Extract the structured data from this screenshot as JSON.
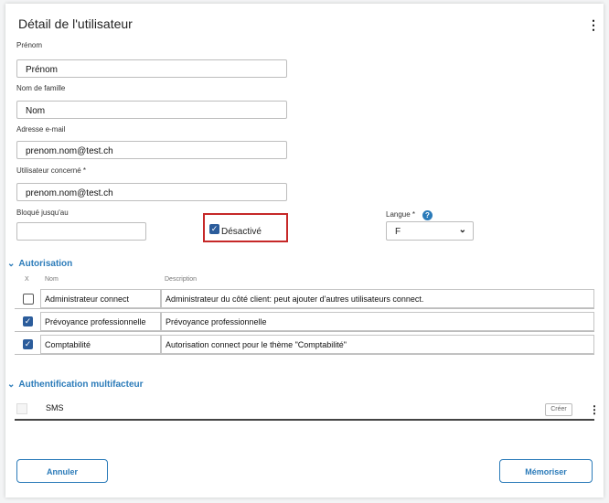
{
  "header": {
    "title": "Détail de l'utilisateur",
    "menu_icon": "more-vertical-icon"
  },
  "form": {
    "first_name": {
      "label": "Prénom",
      "value": "Prénom"
    },
    "last_name": {
      "label": "Nom de famille",
      "value": "Nom"
    },
    "email": {
      "label": "Adresse e-mail",
      "value": "prenom.nom@test.ch"
    },
    "user": {
      "label": "Utilisateur concerné *",
      "value": "prenom.nom@test.ch"
    },
    "blocked_until": {
      "label": "Bloqué jusqu'au",
      "value": ""
    },
    "disabled": {
      "label": "Désactivé",
      "checked": true
    },
    "language": {
      "label": "Langue *",
      "value": "F",
      "help_icon": "help-icon"
    }
  },
  "authorization": {
    "title": "Autorisation",
    "columns": [
      "X",
      "Nom",
      "Description"
    ],
    "rows": [
      {
        "checked": false,
        "name": "Administrateur connect",
        "description": "Administrateur du côté client: peut ajouter d'autres utilisateurs connect."
      },
      {
        "checked": true,
        "name": "Prévoyance professionnelle",
        "description": "Prévoyance professionnelle"
      },
      {
        "checked": true,
        "name": "Comptabilité",
        "description": "Autorisation connect pour le thème \"Comptabilité\""
      }
    ]
  },
  "mfa": {
    "title": "Authentification multifacteur",
    "item_label": "SMS",
    "create_label": "Créer"
  },
  "footer": {
    "cancel_label": "Annuler",
    "save_label": "Mémoriser"
  },
  "colors": {
    "accent": "#2b7bb9",
    "checkbox": "#2b5c9b",
    "highlight_border": "#c62828"
  }
}
